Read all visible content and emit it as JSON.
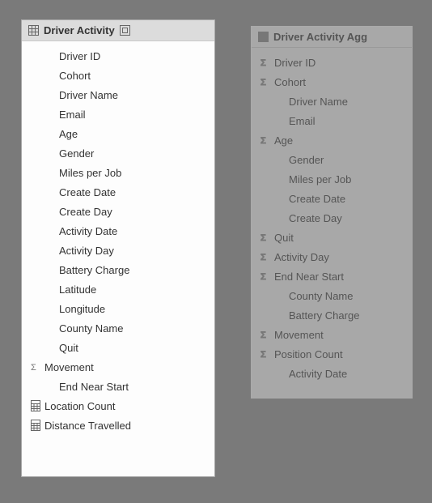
{
  "panels": [
    {
      "id": "panel1",
      "dim": false,
      "title": "Driver Activity",
      "show_o_icon": true,
      "fields": [
        {
          "icon": "",
          "indent": 2,
          "label": "Driver ID"
        },
        {
          "icon": "",
          "indent": 2,
          "label": "Cohort"
        },
        {
          "icon": "",
          "indent": 2,
          "label": "Driver Name"
        },
        {
          "icon": "",
          "indent": 2,
          "label": "Email"
        },
        {
          "icon": "",
          "indent": 2,
          "label": "Age"
        },
        {
          "icon": "",
          "indent": 2,
          "label": "Gender"
        },
        {
          "icon": "",
          "indent": 2,
          "label": "Miles per Job"
        },
        {
          "icon": "",
          "indent": 2,
          "label": "Create Date"
        },
        {
          "icon": "",
          "indent": 2,
          "label": "Create Day"
        },
        {
          "icon": "",
          "indent": 2,
          "label": "Activity Date"
        },
        {
          "icon": "",
          "indent": 2,
          "label": "Activity Day"
        },
        {
          "icon": "",
          "indent": 2,
          "label": "Battery Charge"
        },
        {
          "icon": "",
          "indent": 2,
          "label": "Latitude"
        },
        {
          "icon": "",
          "indent": 2,
          "label": "Longitude"
        },
        {
          "icon": "",
          "indent": 2,
          "label": "County Name"
        },
        {
          "icon": "",
          "indent": 2,
          "label": "Quit"
        },
        {
          "icon": "sigma",
          "indent": 1,
          "label": "Movement"
        },
        {
          "icon": "",
          "indent": 2,
          "label": "End Near Start"
        },
        {
          "icon": "calc",
          "indent": 1,
          "label": "Location Count"
        },
        {
          "icon": "calc",
          "indent": 1,
          "label": "Distance Travelled"
        }
      ]
    },
    {
      "id": "panel2",
      "dim": true,
      "title": "Driver Activity Agg",
      "show_o_icon": false,
      "fields": [
        {
          "icon": "sigma",
          "indent": 1,
          "label": "Driver ID"
        },
        {
          "icon": "sigma",
          "indent": 1,
          "label": "Cohort"
        },
        {
          "icon": "",
          "indent": 2,
          "label": "Driver Name"
        },
        {
          "icon": "",
          "indent": 2,
          "label": "Email"
        },
        {
          "icon": "sigma",
          "indent": 1,
          "label": "Age"
        },
        {
          "icon": "",
          "indent": 2,
          "label": "Gender"
        },
        {
          "icon": "",
          "indent": 2,
          "label": "Miles per Job"
        },
        {
          "icon": "",
          "indent": 2,
          "label": "Create Date"
        },
        {
          "icon": "",
          "indent": 2,
          "label": "Create Day"
        },
        {
          "icon": "sigma",
          "indent": 1,
          "label": "Quit"
        },
        {
          "icon": "sigma",
          "indent": 1,
          "label": "Activity Day"
        },
        {
          "icon": "sigma",
          "indent": 1,
          "label": "End Near Start"
        },
        {
          "icon": "",
          "indent": 2,
          "label": "County Name"
        },
        {
          "icon": "",
          "indent": 2,
          "label": "Battery Charge"
        },
        {
          "icon": "sigma",
          "indent": 1,
          "label": "Movement"
        },
        {
          "icon": "sigma",
          "indent": 1,
          "label": "Position Count"
        },
        {
          "icon": "",
          "indent": 2,
          "label": "Activity Date"
        }
      ]
    }
  ]
}
